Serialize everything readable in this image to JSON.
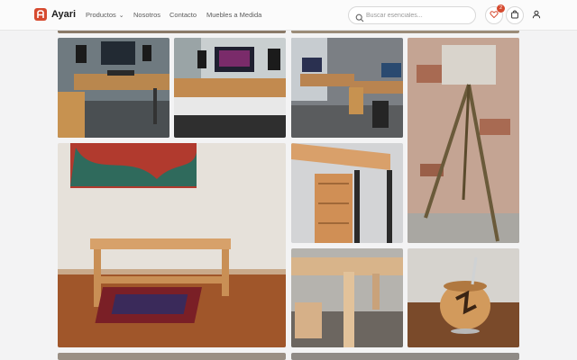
{
  "brand": {
    "name": "Ayari"
  },
  "nav": {
    "productos": "Productos",
    "nosotros": "Nosotros",
    "contacto": "Contacto",
    "muebles": "Muebles a Medida"
  },
  "search": {
    "placeholder": "Buscar esenciales..."
  },
  "actions": {
    "wishlist_count": "2"
  },
  "icons": [
    "logo-icon",
    "chevron-down-icon",
    "search-icon",
    "heart-icon",
    "bag-icon",
    "user-icon"
  ],
  "colors": {
    "accent": "#d64a2f",
    "background": "#f3f3f4"
  },
  "gallery": {
    "items": [
      {
        "alt": "Escritorio de madera con monitores y parlantes"
      },
      {
        "alt": "Escritorio con teclado musical y monitor"
      },
      {
        "alt": "Escritorio en L con monitores"
      },
      {
        "alt": "Lámpara de pie trípode de madera"
      },
      {
        "alt": "Mesa baja de madera sobre alfombra"
      },
      {
        "alt": "Detalle de cajonera de madera con hierro"
      },
      {
        "alt": "Detalle de encastres de madera"
      },
      {
        "alt": "Mate de madera con logo"
      }
    ]
  }
}
